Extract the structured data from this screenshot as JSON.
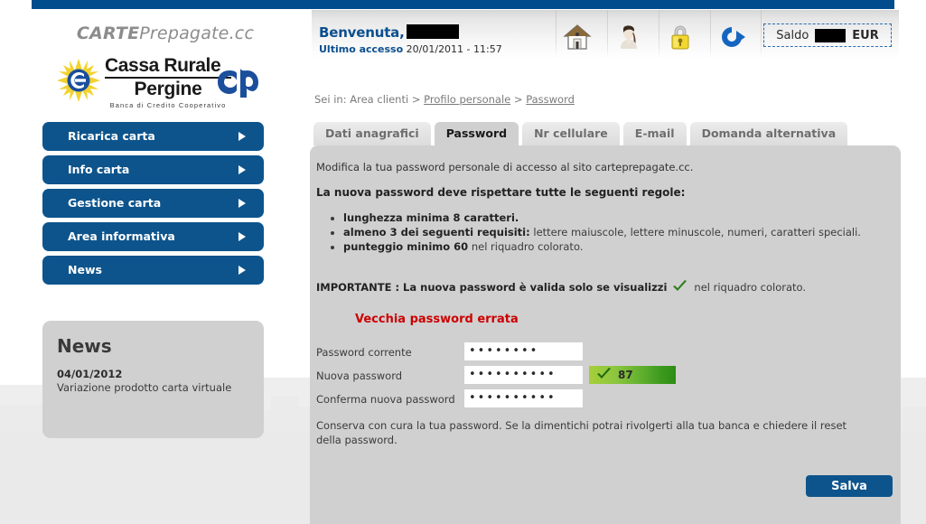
{
  "topbar": {
    "color": "#004c8c"
  },
  "brand": {
    "site_name_part1": "CARTE",
    "site_name_part2": "Prepagate.cc",
    "bank_line1": "Cassa Rurale",
    "bank_line2": "Pergine",
    "bank_line3": "Banca di Credito Cooperativo"
  },
  "sidebar": {
    "items": [
      {
        "label": "Ricarica carta"
      },
      {
        "label": "Info carta"
      },
      {
        "label": "Gestione carta"
      },
      {
        "label": "Area informativa"
      },
      {
        "label": "News"
      }
    ],
    "news_panel": {
      "title": "News",
      "date": "04/01/2012",
      "text": "Variazione prodotto carta virtuale"
    }
  },
  "header": {
    "welcome_label": "Benvenuta,",
    "welcome_name_redacted": true,
    "last_access_label": "Ultimo accesso",
    "last_access_value": "20/01/2011 - 11:57",
    "icons": [
      {
        "name": "home-icon"
      },
      {
        "name": "user-profile-icon"
      },
      {
        "name": "padlock-icon"
      },
      {
        "name": "logout-icon"
      }
    ],
    "balance": {
      "label": "Saldo",
      "value_redacted": true,
      "currency": "EUR"
    }
  },
  "breadcrumb": {
    "prefix": "Sei in:",
    "items": [
      {
        "label": "Area clienti",
        "link": false
      },
      {
        "label": "Profilo personale",
        "link": true
      },
      {
        "label": "Password",
        "link": true
      }
    ],
    "separator": ">"
  },
  "tabs": [
    {
      "label": "Dati anagrafici",
      "active": false
    },
    {
      "label": "Password",
      "active": true
    },
    {
      "label": "Nr cellulare",
      "active": false
    },
    {
      "label": "E-mail",
      "active": false
    },
    {
      "label": "Domanda alternativa",
      "active": false
    }
  ],
  "content": {
    "intro": "Modifica la tua password personale di accesso al sito carteprepagate.cc.",
    "rules_heading": "La nuova password deve rispettare tutte le seguenti regole:",
    "rules": [
      {
        "bold": "lunghezza minima 8 caratteri.",
        "rest": ""
      },
      {
        "bold": "almeno 3 dei seguenti requisiti:",
        "rest": " lettere maiuscole, lettere minuscole, numeri, caratteri speciali."
      },
      {
        "bold": "punteggio minimo 60",
        "rest": " nel riquadro colorato."
      }
    ],
    "important_prefix": "IMPORTANTE : La nuova password è valida solo se visualizzi",
    "important_suffix": "nel riquadro colorato.",
    "error_message": "Vecchia password errata",
    "form": {
      "fields": [
        {
          "label": "Password corrente",
          "value": "••••••••",
          "placeholder": ""
        },
        {
          "label": "Nuova password",
          "value": "••••••••••",
          "placeholder": ""
        },
        {
          "label": "Conferma nuova password",
          "value": "••••••••••",
          "placeholder": ""
        }
      ],
      "strength": {
        "score": "87",
        "valid": true
      }
    },
    "footer_note": "Conserva con cura la tua password. Se la dimentichi potrai rivolgerti alla tua banca e chiedere il reset della password.",
    "save_label": "Salva"
  },
  "colors": {
    "brand_blue": "#0d548c",
    "topbar_blue": "#004c8c",
    "panel_gray": "#d0d0d0",
    "error_red": "#cc0000",
    "check_green": "#2f7d1e"
  }
}
